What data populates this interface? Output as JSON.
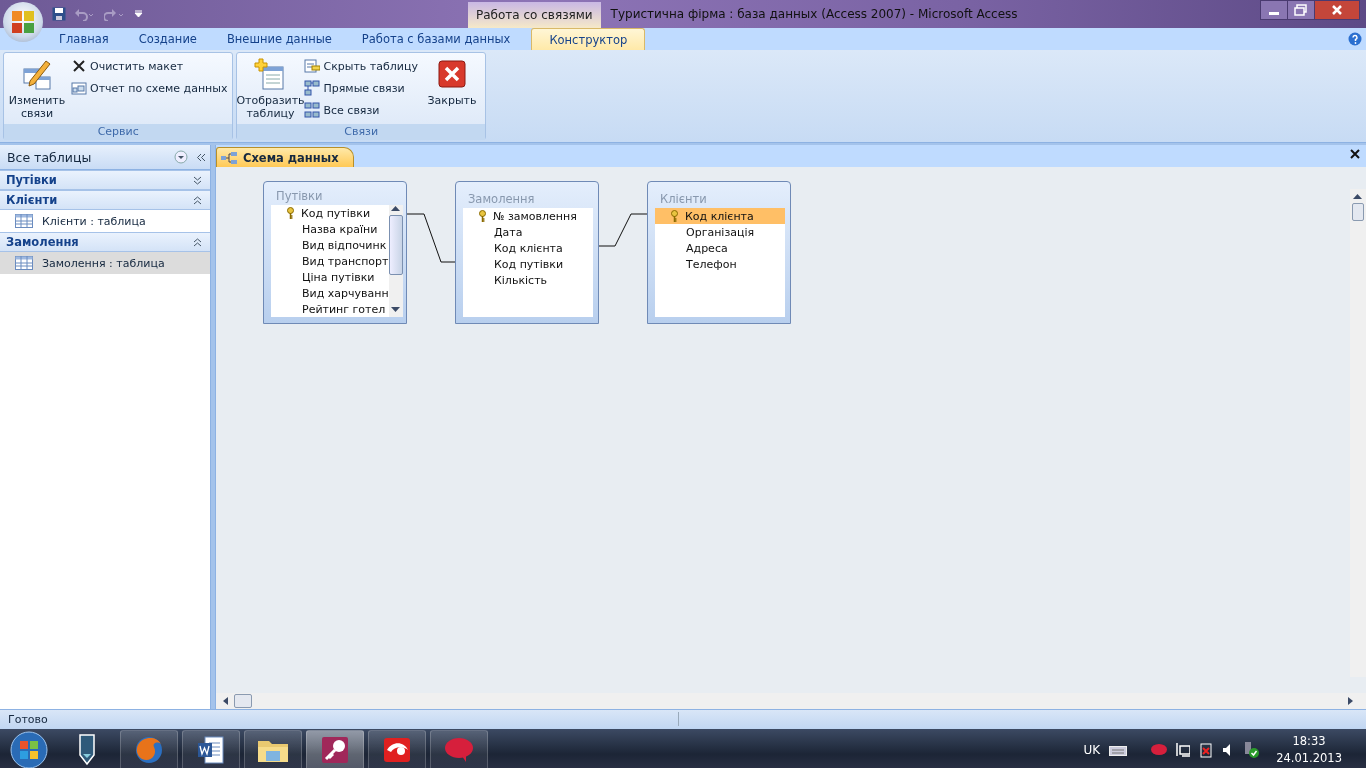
{
  "window": {
    "title": "Туристична фірма : база данных (Access 2007) - Microsoft Access",
    "context_group": "Работа со связями"
  },
  "ribbon_tabs": [
    {
      "label": "Главная",
      "selected": false,
      "kind": "normal"
    },
    {
      "label": "Создание",
      "selected": false,
      "kind": "normal"
    },
    {
      "label": "Внешние данные",
      "selected": false,
      "kind": "normal"
    },
    {
      "label": "Работа с базами данных",
      "selected": false,
      "kind": "normal"
    },
    {
      "label": "Конструктор",
      "selected": true,
      "kind": "contextual"
    }
  ],
  "ribbon_groups": [
    {
      "label": "Сервис",
      "buttons": [
        {
          "label": "Изменить связи",
          "kind": "large"
        },
        {
          "label": "Очистить макет",
          "kind": "small"
        },
        {
          "label": "Отчет по схеме данных",
          "kind": "small"
        }
      ]
    },
    {
      "label": "Связи",
      "buttons": [
        {
          "label": "Отобразить таблицу",
          "kind": "large"
        },
        {
          "label": "Скрыть таблицу",
          "kind": "small"
        },
        {
          "label": "Прямые связи",
          "kind": "small"
        },
        {
          "label": "Все связи",
          "kind": "small"
        },
        {
          "label": "Закрыть",
          "kind": "large"
        }
      ]
    }
  ],
  "nav_pane": {
    "title": "Все таблицы",
    "groups": [
      {
        "label": "Путівки",
        "expanded": false
      },
      {
        "label": "Клієнти",
        "expanded": true,
        "items": [
          {
            "label": "Клієнти : таблица",
            "selected": false
          }
        ]
      },
      {
        "label": "Замолення",
        "expanded": true,
        "items": [
          {
            "label": "Замолення : таблица",
            "selected": true
          }
        ]
      }
    ]
  },
  "document_tabs": [
    {
      "label": "Схема данных",
      "selected": true
    }
  ],
  "diagram_tables": [
    {
      "title": "Путівки",
      "fields": [
        {
          "name": "Код путівки",
          "primary_key": true,
          "selected": false
        },
        {
          "name": "Назва країни",
          "primary_key": false,
          "selected": false
        },
        {
          "name": "Вид відпочинк",
          "primary_key": false,
          "selected": false
        },
        {
          "name": "Вид транспорт",
          "primary_key": false,
          "selected": false
        },
        {
          "name": "Ціна путівки",
          "primary_key": false,
          "selected": false
        },
        {
          "name": "Вид харчуванн",
          "primary_key": false,
          "selected": false
        },
        {
          "name": "Рейтинг готел",
          "primary_key": false,
          "selected": false
        }
      ]
    },
    {
      "title": "Замолення",
      "fields": [
        {
          "name": "№ замовлення",
          "primary_key": true,
          "selected": false
        },
        {
          "name": "Дата",
          "primary_key": false,
          "selected": false
        },
        {
          "name": "Код клієнта",
          "primary_key": false,
          "selected": false
        },
        {
          "name": "Код путівки",
          "primary_key": false,
          "selected": false
        },
        {
          "name": "Кількість",
          "primary_key": false,
          "selected": false
        }
      ]
    },
    {
      "title": "Клієнти",
      "fields": [
        {
          "name": "Код клієнта",
          "primary_key": true,
          "selected": true
        },
        {
          "name": "Організація",
          "primary_key": false,
          "selected": false
        },
        {
          "name": "Адреса",
          "primary_key": false,
          "selected": false
        },
        {
          "name": "Телефон",
          "primary_key": false,
          "selected": false
        }
      ]
    }
  ],
  "status_bar": {
    "text": "Готово"
  },
  "tray": {
    "language": "UK",
    "time": "18:33",
    "date": "24.01.2013"
  }
}
